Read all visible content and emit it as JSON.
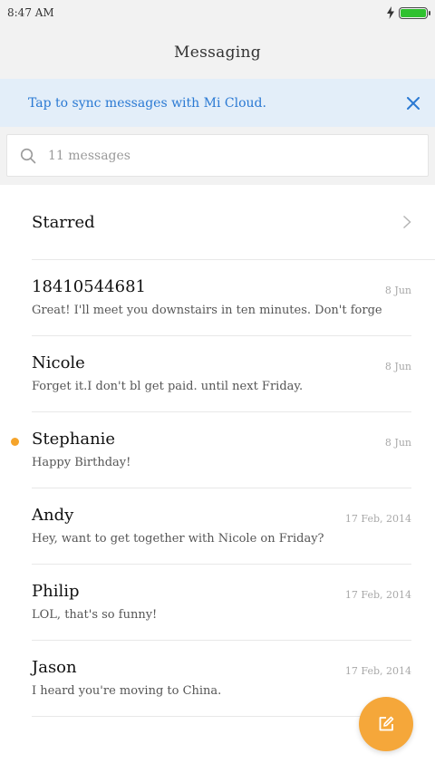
{
  "status": {
    "time": "8:47 AM"
  },
  "header": {
    "title": "Messaging"
  },
  "banner": {
    "text": "Tap to sync messages with Mi Cloud."
  },
  "search": {
    "placeholder": "11 messages"
  },
  "starred": {
    "label": "Starred"
  },
  "conversations": [
    {
      "name": "18410544681",
      "date": "8 Jun",
      "message": "Great! I'll meet you downstairs in ten minutes. Don't forge",
      "unread": false
    },
    {
      "name": "Nicole",
      "date": "8 Jun",
      "message": "Forget it.I don't bl get paid. until next Friday.",
      "unread": false
    },
    {
      "name": "Stephanie",
      "date": "8 Jun",
      "message": "Happy Birthday!",
      "unread": true
    },
    {
      "name": "Andy",
      "date": "17 Feb, 2014",
      "message": "Hey, want to get together with Nicole on Friday?",
      "unread": false
    },
    {
      "name": "Philip",
      "date": "17 Feb, 2014",
      "message": "LOL, that's so funny!",
      "unread": false
    },
    {
      "name": "Jason",
      "date": "17 Feb, 2014",
      "message": "I heard you're moving to China.",
      "unread": false
    }
  ],
  "colors": {
    "accent": "#f5a73a",
    "unread_dot": "#f5a42b",
    "banner_bg": "#e3eef9",
    "banner_text": "#2a79d3",
    "battery": "#2fc12f"
  },
  "icons": {
    "charging": "lightning-icon",
    "battery": "battery-icon",
    "close": "close-icon",
    "search": "search-icon",
    "chevron": "chevron-right-icon",
    "compose": "compose-icon"
  }
}
